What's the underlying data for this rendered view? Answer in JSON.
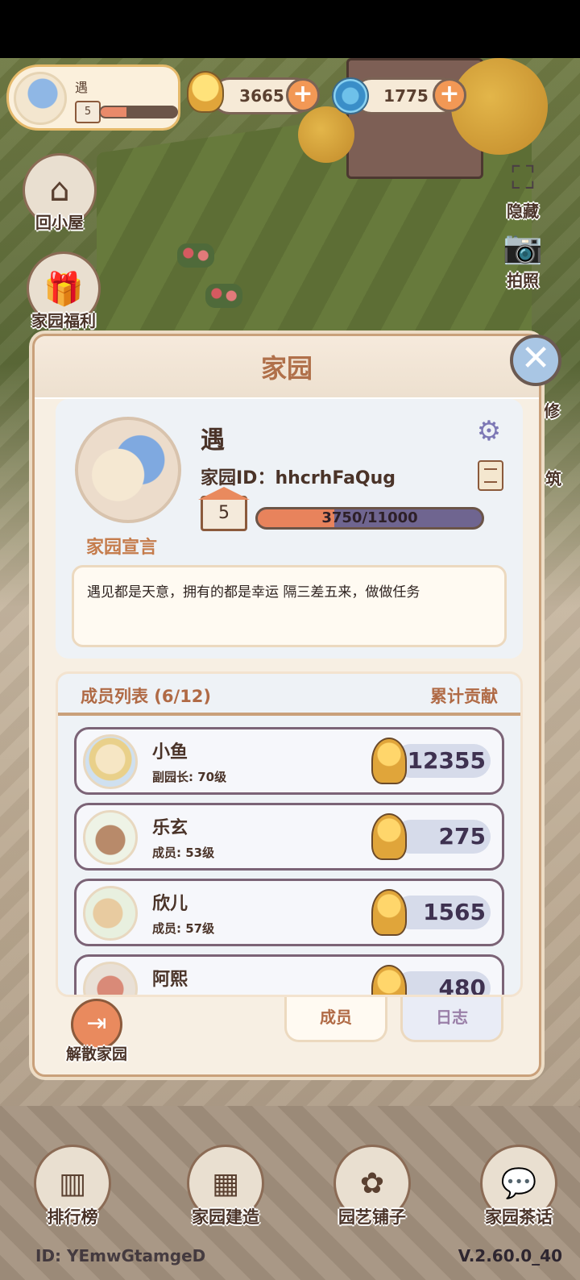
{
  "topbar": {
    "player_name": "遇",
    "home_level": "5",
    "level_progress": 0.34,
    "coins": "3665",
    "gems": "1775"
  },
  "left_buttons": [
    {
      "label": "回小屋",
      "icon": "house-icon"
    },
    {
      "label": "家园福利",
      "icon": "gift-icon"
    }
  ],
  "right_buttons": [
    {
      "label": "隐藏",
      "icon": "hide-icon"
    },
    {
      "label": "拍照",
      "icon": "camera-icon"
    },
    {
      "label": "修",
      "icon": "character-icon"
    },
    {
      "label": "筑",
      "icon": "build-icon"
    }
  ],
  "panel": {
    "title": "家园",
    "home_name": "遇",
    "home_id_label": "家园ID：",
    "home_id_value": "hhcrhFaQug",
    "level": "5",
    "xp_text": "3750/11000",
    "xp_progress": 0.341,
    "declaration_title": "家园宣言",
    "declaration_text": "遇见都是天意，拥有的都是幸运 隔三差五来，做做任务",
    "members_title": "成员列表 (6/12)",
    "contribution_title": "累计贡献",
    "members": [
      {
        "name": "小鱼",
        "role": "副园长: 70级",
        "contribution": "12355"
      },
      {
        "name": "乐玄",
        "role": "成员: 53级",
        "contribution": "275"
      },
      {
        "name": "欣儿",
        "role": "成员: 57级",
        "contribution": "1565"
      },
      {
        "name": "阿熙",
        "role": "",
        "contribution": "480"
      }
    ],
    "tabs": {
      "members": "成员",
      "log": "日志"
    },
    "disband_label": "解散家园"
  },
  "bottom_nav": [
    {
      "label": "排行榜",
      "icon": "ranking-icon"
    },
    {
      "label": "家园建造",
      "icon": "brick-icon"
    },
    {
      "label": "园艺铺子",
      "icon": "plant-basket-icon"
    },
    {
      "label": "家园茶话",
      "icon": "chat-icon"
    }
  ],
  "footer": {
    "id_text": "ID: YEmwGtamgeD",
    "version": "V.2.60.0_40"
  },
  "colors": {
    "accent": "#b06a45",
    "panel_bg": "#f7efe3",
    "xp_fill": "#e8835c"
  }
}
